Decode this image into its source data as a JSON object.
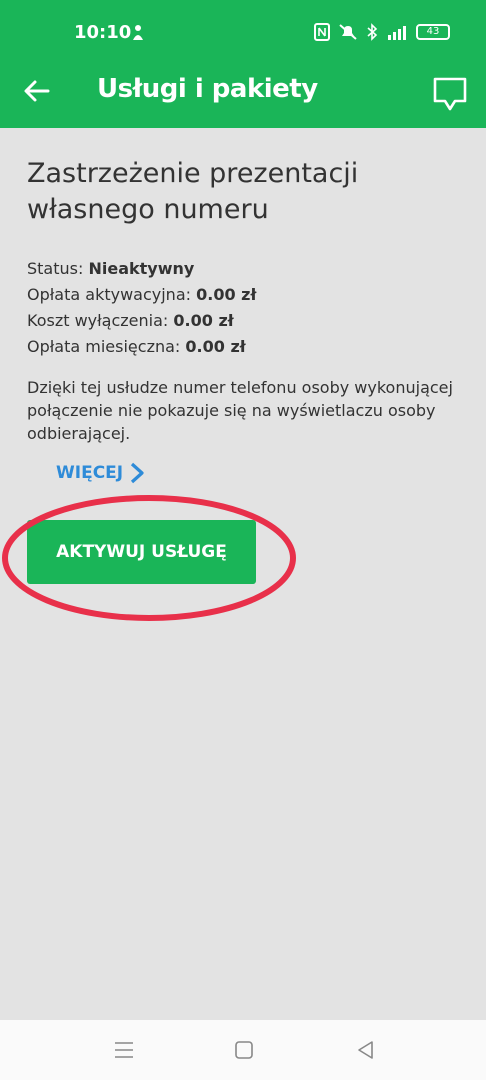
{
  "status_bar": {
    "time": "10:10",
    "battery": "43",
    "icons": [
      "nfc-icon",
      "mute-icon",
      "bluetooth-icon",
      "lte-signal-icon",
      "battery-icon"
    ]
  },
  "header": {
    "title": "Usługi i pakiety",
    "background_color": "#1ab558"
  },
  "service": {
    "title": "Zastrzeżenie prezentacji własnego numeru",
    "status_label": "Status: ",
    "status_value": "Nieaktywny",
    "activation_fee_label": "Opłata aktywacyjna: ",
    "activation_fee_value": "0.00 zł",
    "deactivation_cost_label": "Koszt wyłączenia: ",
    "deactivation_cost_value": "0.00 zł",
    "monthly_fee_label": "Opłata miesięczna: ",
    "monthly_fee_value": "0.00 zł",
    "description": "Dzięki tej usłudze numer telefonu osoby wykonującej połączenie nie pokazuje się na wyświetlaczu osoby odbierającej."
  },
  "actions": {
    "more_label": "WIĘCEJ",
    "activate_label": "AKTYWUJ USŁUGĘ",
    "accent_color": "#1ab558",
    "link_color": "#2e8bd8",
    "annotation_color": "#e8304a"
  },
  "nav_bar": {
    "buttons": [
      "menu-icon",
      "home-icon",
      "back-triangle-icon"
    ]
  }
}
